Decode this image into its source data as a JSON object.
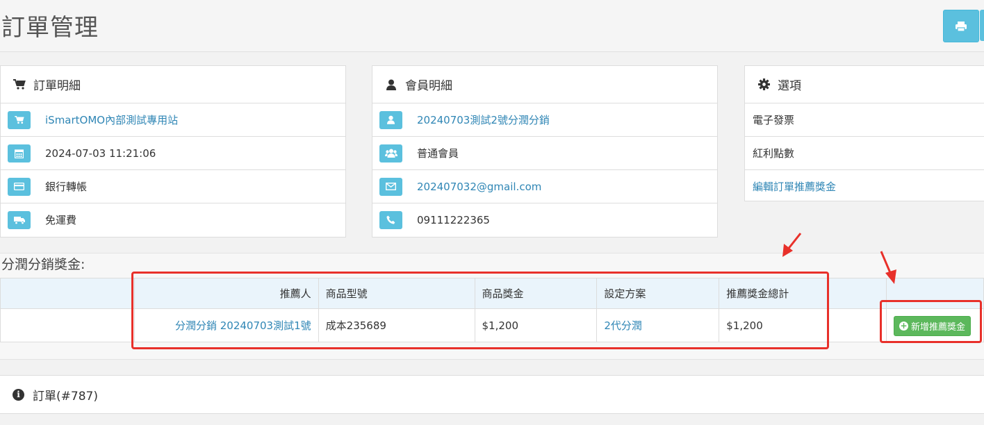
{
  "header": {
    "title": "訂單管理"
  },
  "order_details": {
    "heading": "訂單明細",
    "store": "iSmartOMO內部測試專用站",
    "date": "2024-07-03 11:21:06",
    "payment": "銀行轉帳",
    "shipping": "免運費"
  },
  "member_details": {
    "heading": "會員明細",
    "name": "20240703測試2號分潤分銷",
    "group": "普通會員",
    "email": "202407032@gmail.com",
    "phone": "09111222365"
  },
  "options": {
    "heading": "選項",
    "items": [
      "電子發票",
      "紅利點數",
      "編輯訂單推薦獎金"
    ]
  },
  "bonus": {
    "title": "分潤分銷獎金:",
    "columns": [
      "推薦人",
      "商品型號",
      "商品獎金",
      "設定方案",
      "推薦獎金總計"
    ],
    "rows": [
      {
        "referrer": "分潤分銷 20240703測試1號",
        "model": "成本235689",
        "bonus": "$1,200",
        "plan": "2代分潤",
        "total": "$1,200"
      }
    ],
    "add_button": "新增推薦獎金"
  },
  "order_section": {
    "heading": "訂單(#787)"
  },
  "colors": {
    "info": "#5bc0de",
    "success": "#5cb85c",
    "link": "#2f86b5",
    "annotation": "#e8302a"
  }
}
